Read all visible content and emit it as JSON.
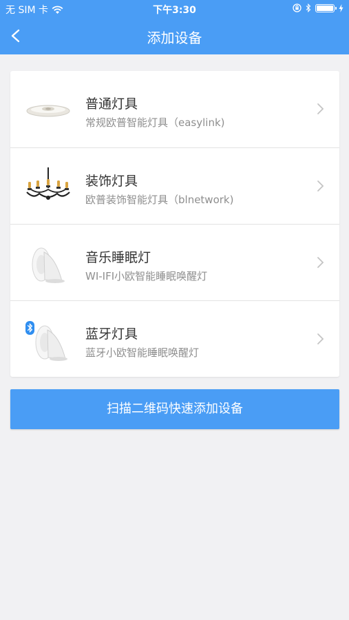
{
  "status_bar": {
    "carrier": "无 SIM 卡",
    "time": "下午3:30",
    "battery_level": 1.0
  },
  "nav": {
    "title": "添加设备",
    "back_icon": "chevron-left-icon"
  },
  "devices": [
    {
      "title": "普通灯具",
      "subtitle": "常规欧普智能灯具（easylink)",
      "icon": "ceiling-lamp-icon"
    },
    {
      "title": "装饰灯具",
      "subtitle": "欧普装饰智能灯具（blnetwork)",
      "icon": "chandelier-icon"
    },
    {
      "title": "音乐睡眠灯",
      "subtitle": "WI-IFI小欧智能睡眠唤醒灯",
      "icon": "sleep-lamp-icon"
    },
    {
      "title": "蓝牙灯具",
      "subtitle": "蓝牙小欧智能睡眠唤醒灯",
      "icon": "bluetooth-lamp-icon"
    }
  ],
  "scan_button": {
    "label": "扫描二维码快速添加设备"
  },
  "colors": {
    "accent": "#4a9df5",
    "background": "#f1f1f3",
    "bluetooth": "#2f8ef0"
  }
}
